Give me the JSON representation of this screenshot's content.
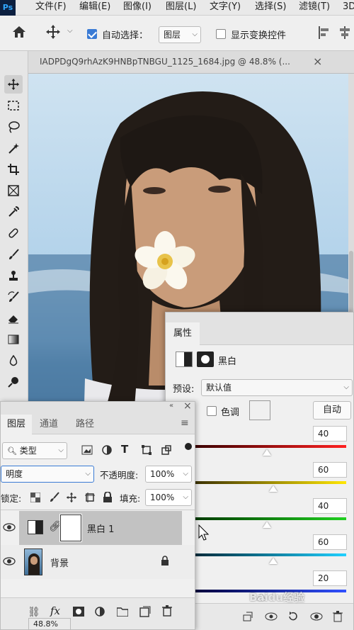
{
  "menubar": {
    "app_badge": "Ps",
    "items": [
      "文件(F)",
      "编辑(E)",
      "图像(I)",
      "图层(L)",
      "文字(Y)",
      "选择(S)",
      "滤镜(T)",
      "3D"
    ]
  },
  "options": {
    "auto_select_label": "自动选择：",
    "auto_select_target": "图层",
    "show_transform_label": "显示变换控件"
  },
  "document": {
    "tab_title": "IADPDgQ9rhAzK9HNBpTNBGU_1125_1684.jpg @ 48.8% (...",
    "zoom_display": "48.8%"
  },
  "properties": {
    "tab_label": "属性",
    "adjustment_name": "黑白",
    "preset_label": "预设:",
    "preset_value": "默认值",
    "tint_label": "色调",
    "auto_button": "自动",
    "sliders": [
      {
        "value": "40",
        "level": 40,
        "colors": [
          "#3a0000",
          "#ff2020"
        ]
      },
      {
        "value": "60",
        "level": 60,
        "colors": [
          "#3a3000",
          "#ffe600"
        ]
      },
      {
        "value": "40",
        "level": 40,
        "colors": [
          "#003a00",
          "#20d020"
        ]
      },
      {
        "value": "60",
        "level": 60,
        "colors": [
          "#002a3a",
          "#20d0ff"
        ]
      },
      {
        "value": "20",
        "level": 20,
        "colors": [
          "#00003a",
          "#3050ff"
        ]
      }
    ]
  },
  "layers": {
    "tabs": [
      "图层",
      "通道",
      "路径"
    ],
    "filter_kind": "类型",
    "blend_mode": "明度",
    "opacity_label": "不透明度:",
    "opacity_value": "100%",
    "lock_label": "锁定:",
    "fill_label": "填充:",
    "fill_value": "100%",
    "items": [
      {
        "name": "黑白 1",
        "selected": true
      },
      {
        "name": "背景",
        "selected": false
      }
    ],
    "footer_fx": "fx"
  },
  "watermark": "Baidu经验"
}
